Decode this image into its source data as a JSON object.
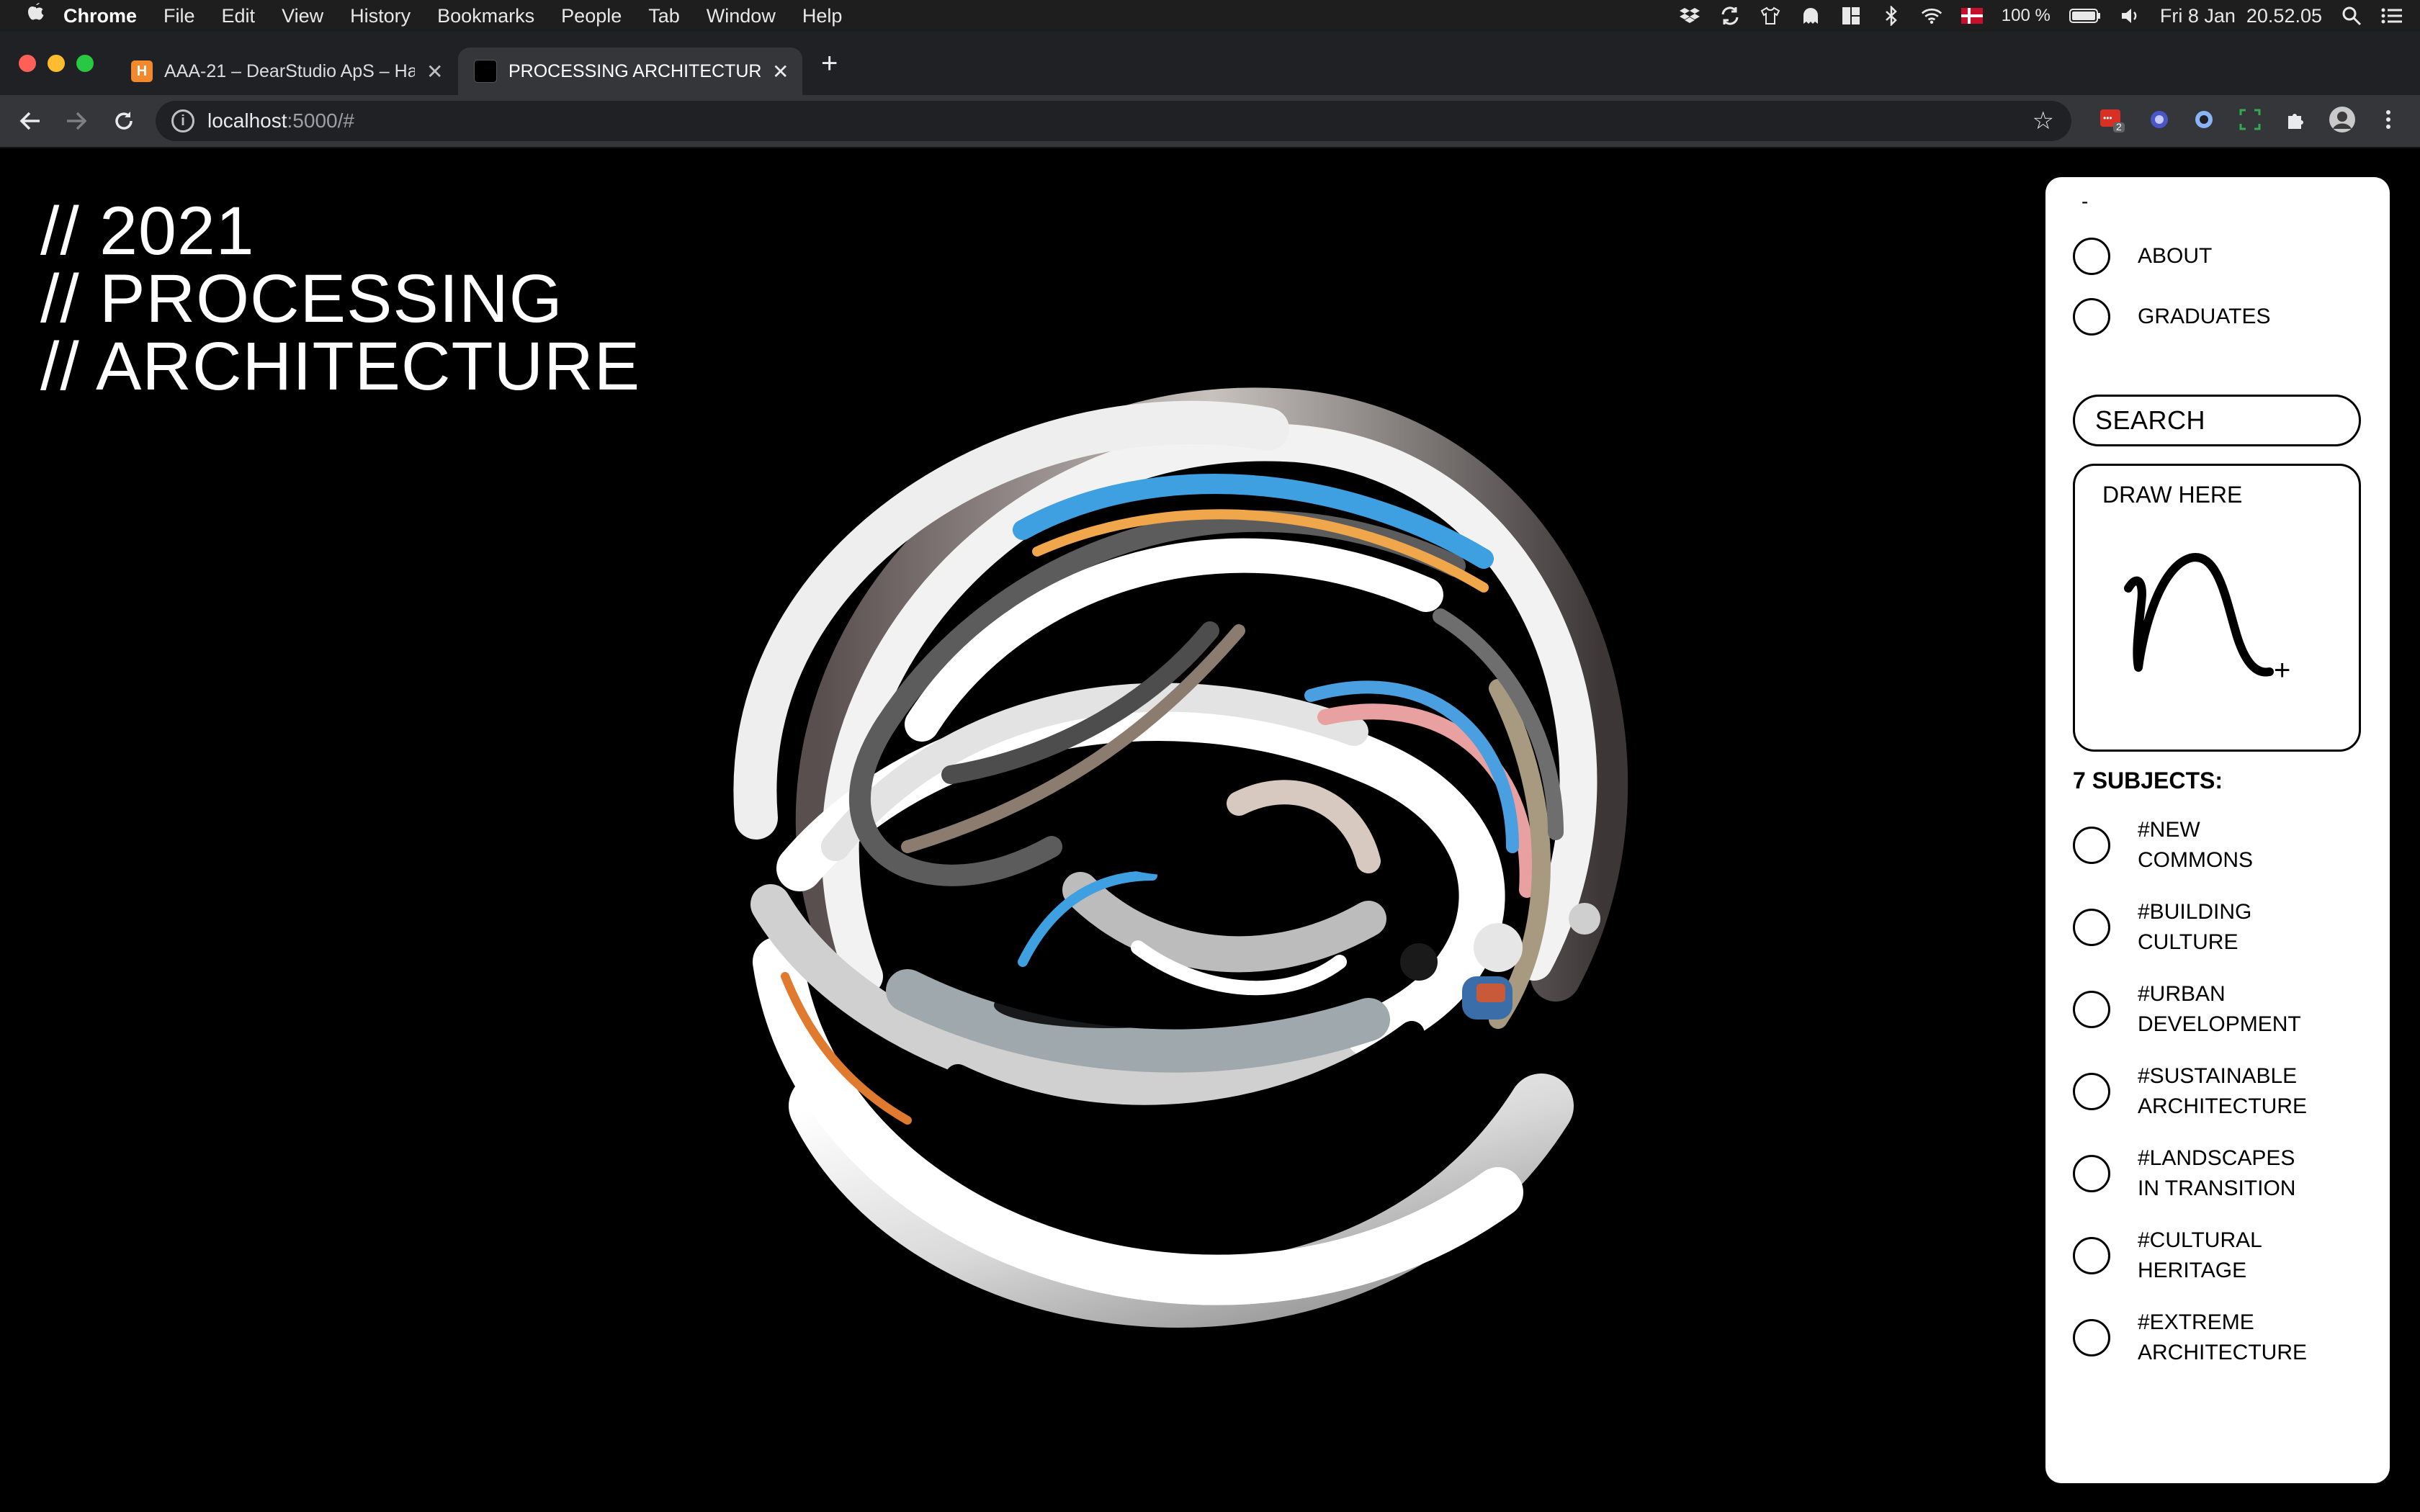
{
  "menubar": {
    "app": "Chrome",
    "items": [
      "File",
      "Edit",
      "View",
      "History",
      "Bookmarks",
      "People",
      "Tab",
      "Window",
      "Help"
    ],
    "battery": "100 %",
    "clock": "Fri 8 Jan  20.52.05"
  },
  "tabs": [
    {
      "title": "AAA-21 – DearStudio ApS – Ha",
      "favicon": "H",
      "favicon_color": "#f28a2d"
    },
    {
      "title": "PROCESSING ARCHITECTURE",
      "favicon": "",
      "favicon_color": "#000000"
    }
  ],
  "address": {
    "host": "localhost",
    "path": ":5000/#"
  },
  "extension_badge": "2",
  "site": {
    "title_lines": [
      "// 2021",
      "// PROCESSING",
      "// ARCHITECTURE"
    ]
  },
  "panel": {
    "dash": "-",
    "nav": [
      {
        "label": "ABOUT"
      },
      {
        "label": "GRADUATES"
      }
    ],
    "search_label": "SEARCH",
    "draw_label": "DRAW HERE",
    "subjects_heading": "7 SUBJECTS:",
    "subjects": [
      "#NEW\nCOMMONS",
      "#BUILDING\nCULTURE",
      "#URBAN\nDEVELOPMENT",
      "#SUSTAINABLE\nARCHITECTURE",
      "#LANDSCAPES\nIN TRANSITION",
      "#CULTURAL\nHERITAGE",
      "#EXTREME\nARCHITECTURE"
    ]
  }
}
